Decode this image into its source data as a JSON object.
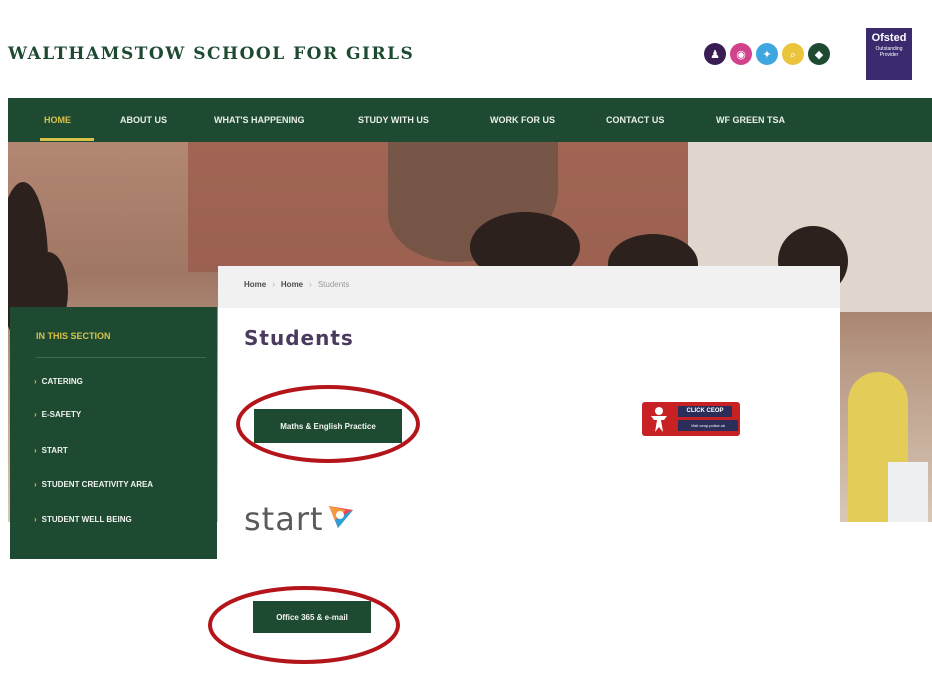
{
  "header": {
    "site_title": "WALTHAMSTOW SCHOOL FOR GIRLS",
    "social_icons": [
      {
        "name": "user-icon",
        "glyph": "♟",
        "color": "#3a1d52"
      },
      {
        "name": "instagram-icon",
        "glyph": "◉",
        "color": "#d2418c"
      },
      {
        "name": "twitter-icon",
        "glyph": "✦",
        "color": "#3fa7e0"
      },
      {
        "name": "search-icon",
        "glyph": "⌕",
        "color": "#eac43a"
      },
      {
        "name": "location-icon",
        "glyph": "◆",
        "color": "#1f4a32"
      }
    ],
    "ofsted": {
      "name": "Ofsted",
      "subtitle": "Outstanding Provider"
    }
  },
  "nav": {
    "items": [
      {
        "label": "HOME",
        "active": true
      },
      {
        "label": "ABOUT US"
      },
      {
        "label": "WHAT'S HAPPENING"
      },
      {
        "label": "STUDY WITH US"
      },
      {
        "label": "WORK FOR US"
      },
      {
        "label": "CONTACT US"
      },
      {
        "label": "WF GREEN TSA"
      }
    ]
  },
  "breadcrumb": {
    "items": [
      "Home",
      "Home",
      "Students"
    ]
  },
  "sidebar": {
    "title": "IN THIS SECTION",
    "items": [
      "CATERING",
      "E-SAFETY",
      "START",
      "STUDENT CREATIVITY AREA",
      "STUDENT WELL BEING"
    ]
  },
  "main": {
    "page_title": "Students",
    "maths_button": "Maths & English Practice",
    "office_button": "Office 365 & e-mail",
    "ceop": {
      "title": "CLICK CEOP",
      "url": "Visit ceop.police.uk"
    },
    "start_logo_text": "start"
  },
  "colors": {
    "brand_green": "#1f4a32",
    "accent_gold": "#d6c24a",
    "annotation_red": "#b3151b",
    "title_purple": "#4a3b5e"
  }
}
